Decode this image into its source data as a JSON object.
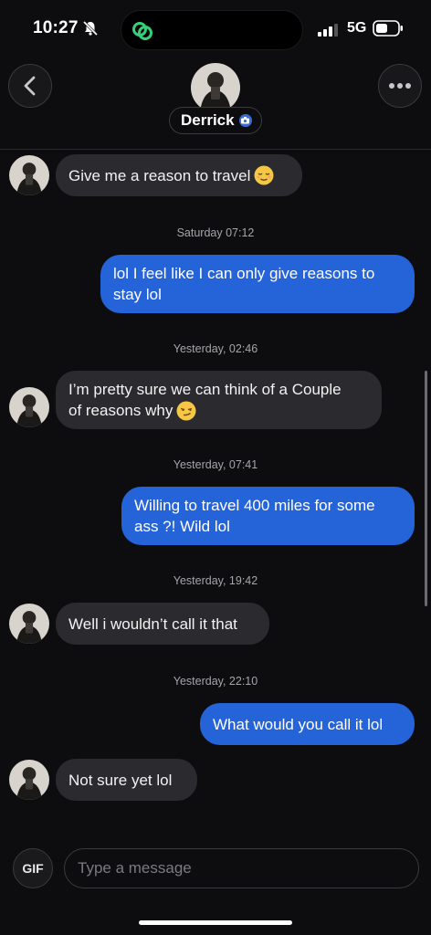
{
  "status_bar": {
    "time": "10:27",
    "network": "5G"
  },
  "header": {
    "contact_name": "Derrick"
  },
  "messages": [
    {
      "type": "incoming",
      "text": "Give me a reason to travel",
      "emoji": "relieved-face"
    },
    {
      "type": "timestamp",
      "text": "Saturday 07:12"
    },
    {
      "type": "outgoing",
      "lines": [
        "lol I feel like I can only give reasons to",
        "stay lol"
      ]
    },
    {
      "type": "timestamp",
      "text": "Yesterday, 02:46"
    },
    {
      "type": "incoming",
      "lines": [
        "I’m pretty sure we can think of a Couple",
        "of reasons why"
      ],
      "emoji": "smirking-face"
    },
    {
      "type": "timestamp",
      "text": "Yesterday, 07:41"
    },
    {
      "type": "outgoing",
      "lines": [
        "Willing to travel 400 miles for some",
        "ass ?! Wild lol"
      ]
    },
    {
      "type": "timestamp",
      "text": "Yesterday, 19:42"
    },
    {
      "type": "incoming",
      "text": "Well i wouldn’t call it that"
    },
    {
      "type": "timestamp",
      "text": "Yesterday, 22:10"
    },
    {
      "type": "outgoing",
      "text": "What would you call it lol"
    },
    {
      "type": "incoming",
      "text": "Not sure yet lol"
    }
  ],
  "composer": {
    "gif_label": "GIF",
    "placeholder": "Type a message"
  },
  "colors": {
    "background": "#0d0d0f",
    "incoming_bubble": "#2b2b2f",
    "outgoing_bubble": "#2563d9"
  }
}
